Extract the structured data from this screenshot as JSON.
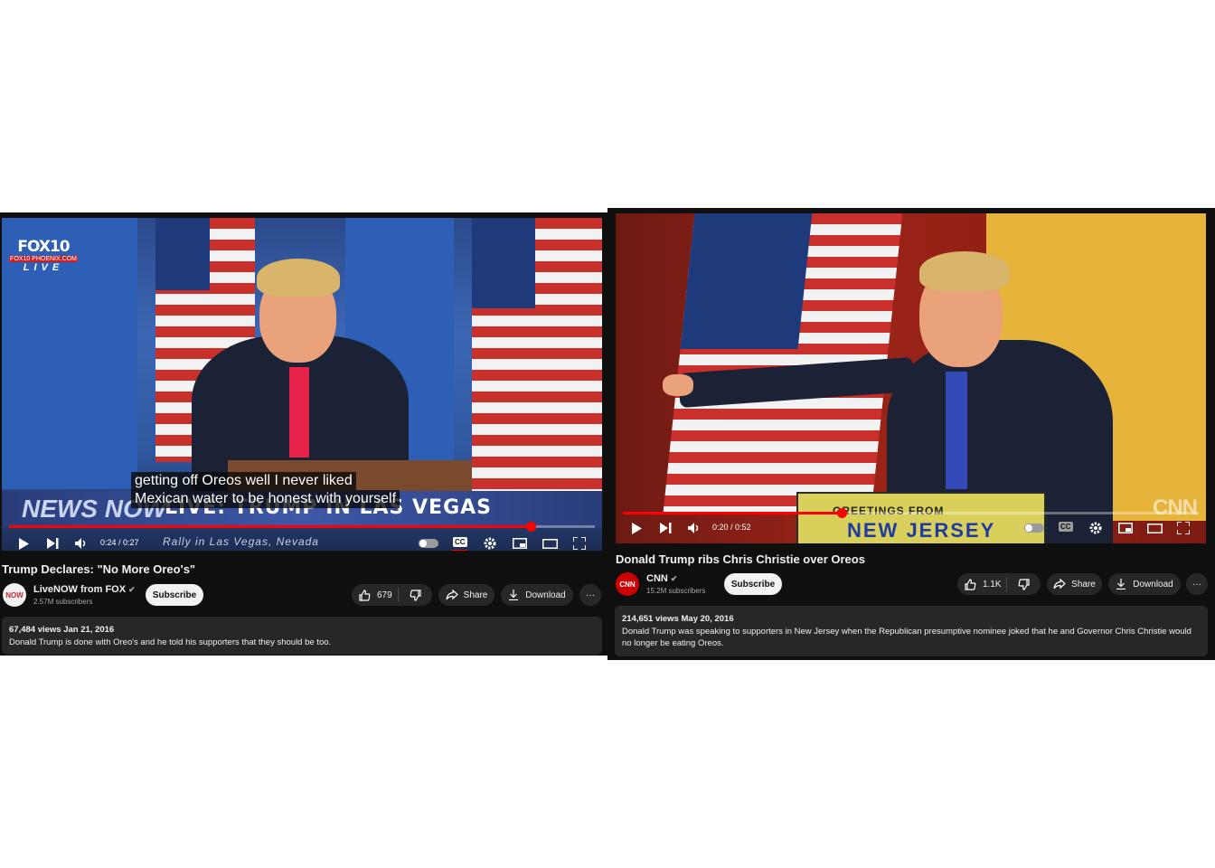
{
  "left": {
    "overlay": {
      "station": "FOX10",
      "station_sub": "FOX10 PHOENIX.COM",
      "live": "LIVE",
      "lower_third_brand": "NEWS NOW",
      "lower_third_title": "LIVE: TRUMP IN LAS VEGAS",
      "lower_third_sub": "Rally in Las Vegas, Nevada"
    },
    "caption_lines": [
      "getting off Oreos well I never liked",
      "Mexican water to be honest with yourself"
    ],
    "player": {
      "time": "0:24 / 0:27",
      "progress": 0.89,
      "cc_label": "CC"
    },
    "title": "Trump Declares: \"No More Oreo's\"",
    "channel": {
      "name": "LiveNOW from FOX",
      "avatar_text": "NOW",
      "subscribers": "2.57M subscribers"
    },
    "subscribe_label": "Subscribe",
    "likes": "679",
    "share_label": "Share",
    "download_label": "Download",
    "more_label": "···",
    "description": {
      "meta": "67,484 views  Jan 21, 2016",
      "text": "Donald Trump is done with Oreo's and he told his supporters that they should be too."
    }
  },
  "right": {
    "overlay": {
      "sign_top": "GREETINGS FROM",
      "sign_main": "NEW JERSEY",
      "watermark": "CNN"
    },
    "player": {
      "time": "0:20 / 0:52",
      "progress": 0.38,
      "cc_label": "CC"
    },
    "title": "Donald Trump ribs Chris Christie over Oreos",
    "channel": {
      "name": "CNN",
      "avatar_text": "CNN",
      "subscribers": "15.2M subscribers"
    },
    "subscribe_label": "Subscribe",
    "likes": "1.1K",
    "share_label": "Share",
    "download_label": "Download",
    "more_label": "···",
    "description": {
      "meta": "214,651 views  May 20, 2016",
      "text": "Donald Trump was speaking to supporters in New Jersey when the Republican presumptive nominee joked that he and Governor Chris Christie would no longer be eating Oreos."
    }
  },
  "colors": {
    "player_bg": "#0f0f0f",
    "accent_red": "#ff0000",
    "pill_bg": "#272727"
  }
}
